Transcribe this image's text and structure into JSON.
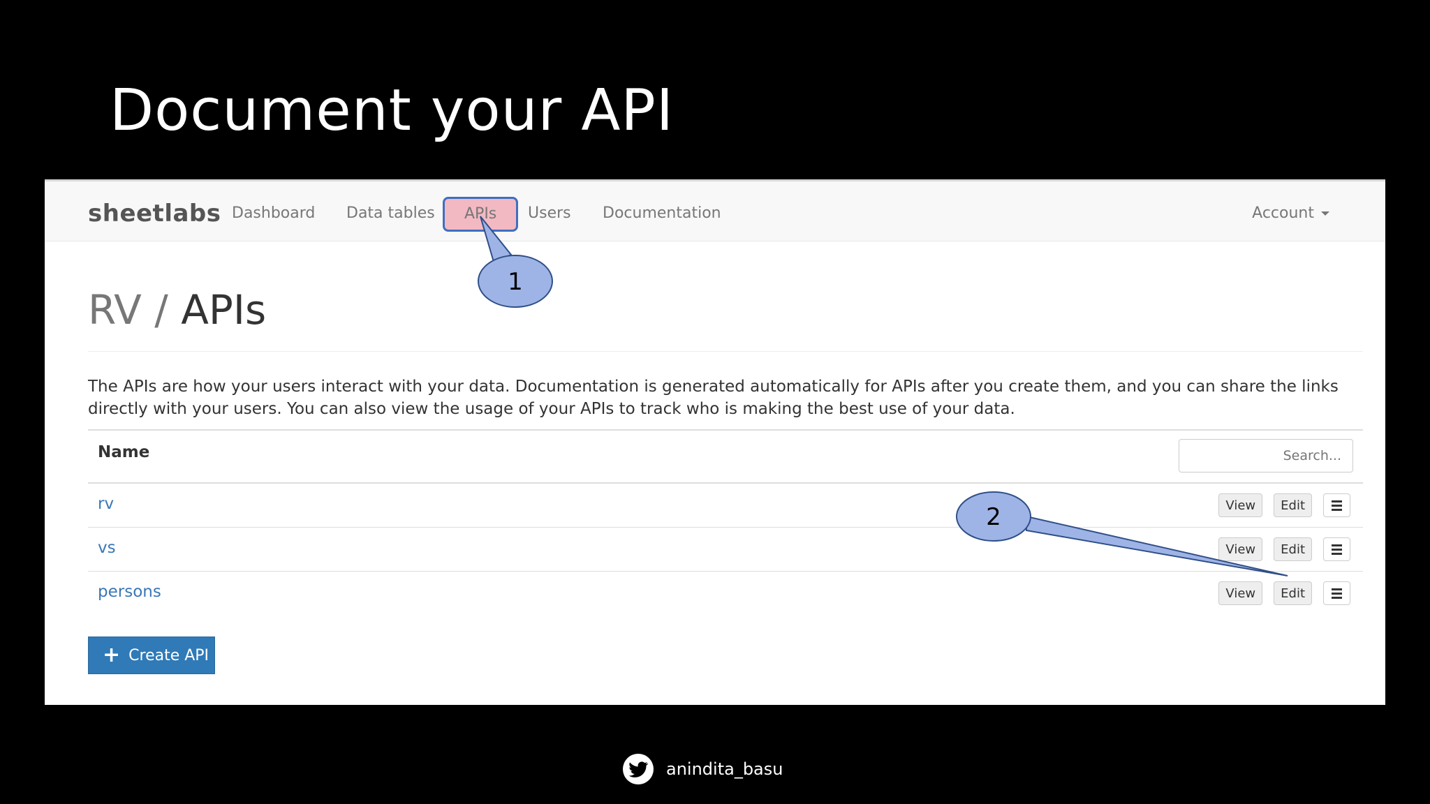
{
  "slide": {
    "title": "Document your API"
  },
  "app": {
    "brand": "sheetlabs",
    "nav": [
      "Dashboard",
      "Data tables",
      "APIs",
      "Users",
      "Documentation"
    ],
    "account": "Account",
    "breadcrumb_muted": "RV / ",
    "page_title": "APIs",
    "description": "The APIs are how your users interact with your data. Documentation is generated automatically for APIs after you create them, and you can share the links directly with your users. You can also view the usage of your APIs to track who is making the best use of your data.",
    "table": {
      "header_name": "Name",
      "search_placeholder": "Search...",
      "rows": [
        {
          "name": "rv",
          "view": "View",
          "edit": "Edit"
        },
        {
          "name": "vs",
          "view": "View",
          "edit": "Edit"
        },
        {
          "name": "persons",
          "view": "View",
          "edit": "Edit"
        }
      ]
    },
    "create_label": "Create API"
  },
  "callouts": [
    "1",
    "2"
  ],
  "footer": {
    "handle": "anindita_basu",
    "icon": "twitter-icon"
  },
  "colors": {
    "primary": "#2f7ab7",
    "callout_fill": "#9fb4e6",
    "callout_stroke": "#2f4f88",
    "highlight": "#f3b9c2"
  }
}
